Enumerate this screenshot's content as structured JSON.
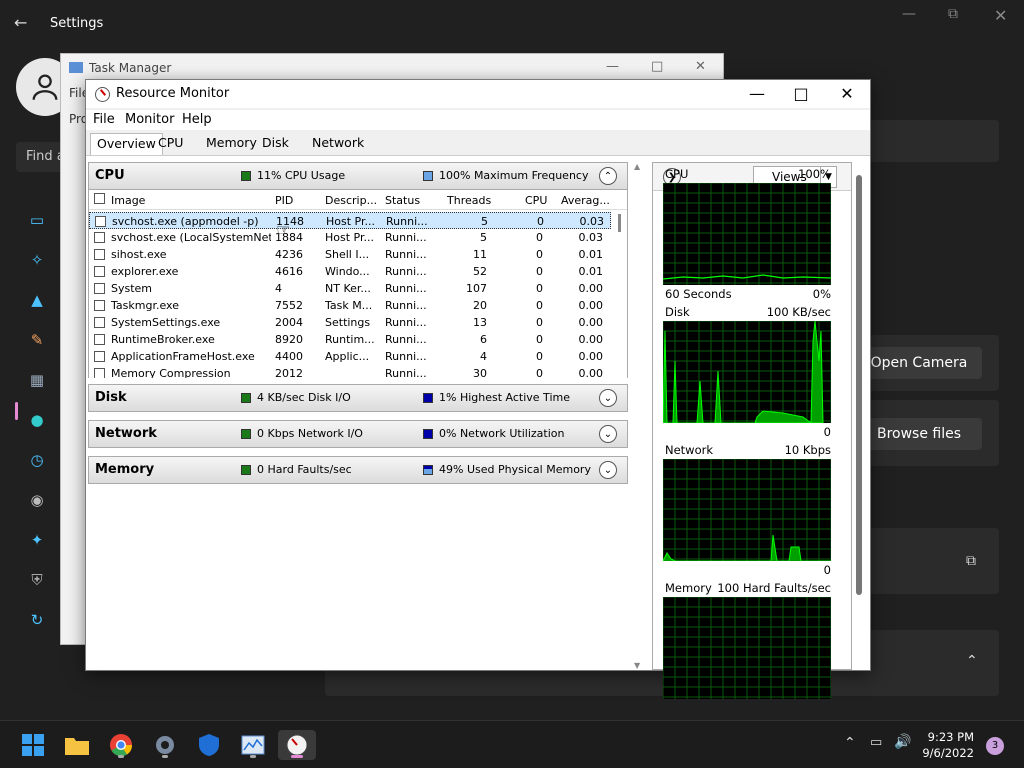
{
  "settings": {
    "title": "Settings",
    "search_placeholder": "Find a",
    "open_camera_label": "Open Camera",
    "browse_files_label": "Browse files"
  },
  "task_manager": {
    "title": "Task Manager",
    "menu_file": "File",
    "menu_pro": "Pro"
  },
  "resource_monitor": {
    "title": "Resource Monitor",
    "menus": [
      "File",
      "Monitor",
      "Help"
    ],
    "tabs": [
      "Overview",
      "CPU",
      "Memory",
      "Disk",
      "Network"
    ],
    "active_tab": "Overview",
    "cpu": {
      "name": "CPU",
      "usage_text": "11% CPU Usage",
      "frequency_text": "100% Maximum Frequency",
      "columns": [
        "Image",
        "PID",
        "Descrip...",
        "Status",
        "Threads",
        "CPU",
        "Averag..."
      ],
      "rows": [
        {
          "image": "svchost.exe (appmodel -p)",
          "pid": "1148",
          "desc": "Host Pr...",
          "status": "Runni...",
          "threads": "5",
          "cpu": "0",
          "avg": "0.03"
        },
        {
          "image": "svchost.exe (LocalSystemNet...",
          "pid": "1884",
          "desc": "Host Pr...",
          "status": "Runni...",
          "threads": "5",
          "cpu": "0",
          "avg": "0.03"
        },
        {
          "image": "sihost.exe",
          "pid": "4236",
          "desc": "Shell I...",
          "status": "Runni...",
          "threads": "11",
          "cpu": "0",
          "avg": "0.01"
        },
        {
          "image": "explorer.exe",
          "pid": "4616",
          "desc": "Windo...",
          "status": "Runni...",
          "threads": "52",
          "cpu": "0",
          "avg": "0.01"
        },
        {
          "image": "System",
          "pid": "4",
          "desc": "NT Ker...",
          "status": "Runni...",
          "threads": "107",
          "cpu": "0",
          "avg": "0.00"
        },
        {
          "image": "Taskmgr.exe",
          "pid": "7552",
          "desc": "Task M...",
          "status": "Runni...",
          "threads": "20",
          "cpu": "0",
          "avg": "0.00"
        },
        {
          "image": "SystemSettings.exe",
          "pid": "2004",
          "desc": "Settings",
          "status": "Runni...",
          "threads": "13",
          "cpu": "0",
          "avg": "0.00"
        },
        {
          "image": "RuntimeBroker.exe",
          "pid": "8920",
          "desc": "Runtim...",
          "status": "Runni...",
          "threads": "6",
          "cpu": "0",
          "avg": "0.00"
        },
        {
          "image": "ApplicationFrameHost.exe",
          "pid": "4400",
          "desc": "Applic...",
          "status": "Runni...",
          "threads": "4",
          "cpu": "0",
          "avg": "0.00"
        },
        {
          "image": "Memory Compression",
          "pid": "2012",
          "desc": "",
          "status": "Runni...",
          "threads": "30",
          "cpu": "0",
          "avg": "0.00"
        }
      ]
    },
    "disk": {
      "name": "Disk",
      "io_text": "4 KB/sec Disk I/O",
      "active_text": "1% Highest Active Time"
    },
    "network": {
      "name": "Network",
      "io_text": "0 Kbps Network I/O",
      "util_text": "0% Network Utilization"
    },
    "memory": {
      "name": "Memory",
      "faults_text": "0 Hard Faults/sec",
      "used_text": "49% Used Physical Memory"
    },
    "right_panel": {
      "views_label": "Views",
      "graphs": [
        {
          "title": "CPU",
          "max": "100%",
          "bottom_left": "60 Seconds",
          "bottom_right": "0%"
        },
        {
          "title": "Disk",
          "max": "100 KB/sec",
          "bottom_left": "",
          "bottom_right": "0"
        },
        {
          "title": "Network",
          "max": "10 Kbps",
          "bottom_left": "",
          "bottom_right": "0"
        },
        {
          "title": "Memory",
          "max": "100 Hard Faults/sec",
          "bottom_left": "",
          "bottom_right": ""
        }
      ]
    }
  },
  "taskbar": {
    "time": "9:23 PM",
    "date": "9/6/2022",
    "notifications": "3"
  },
  "colors": {
    "accent": "#0078d4",
    "cpu_legend_green": "#1a7a1a",
    "cpu_legend_blue": "#6aa6e6",
    "dark_blue_legend": "#0000aa",
    "graph_line": "#00ff00"
  }
}
